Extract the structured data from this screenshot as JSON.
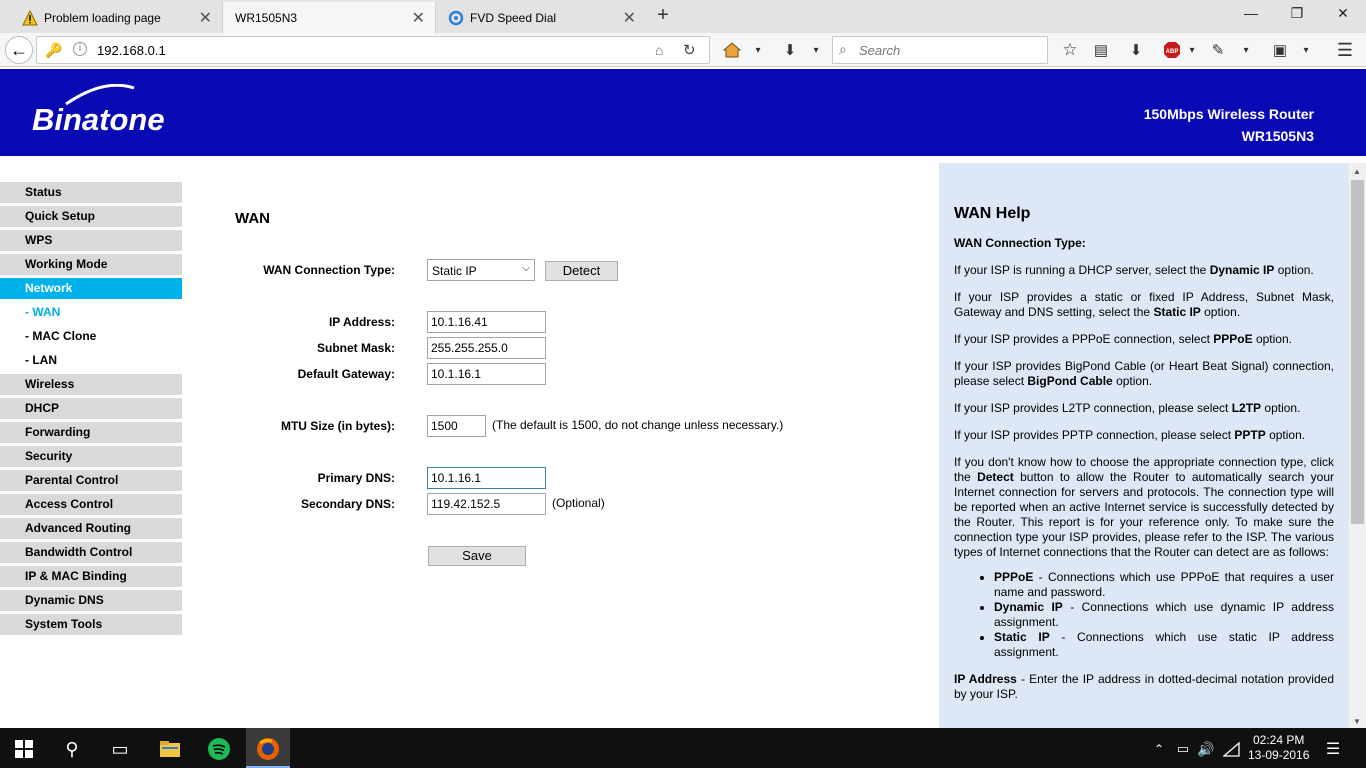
{
  "browser": {
    "tabs": [
      {
        "title": "Problem loading page"
      },
      {
        "title": "WR1505N3"
      },
      {
        "title": "FVD Speed Dial"
      }
    ],
    "url": "192.168.0.1",
    "search_placeholder": "Search"
  },
  "header": {
    "logo": "Binatone",
    "product_line1": "150Mbps Wireless Router",
    "product_line2": "WR1505N3"
  },
  "menu": [
    {
      "label": "Status"
    },
    {
      "label": "Quick Setup"
    },
    {
      "label": "WPS"
    },
    {
      "label": "Working Mode"
    },
    {
      "label": "Network",
      "selected": true
    },
    {
      "label": "- WAN",
      "sub": true,
      "selected": true
    },
    {
      "label": "- MAC Clone",
      "sub": true
    },
    {
      "label": "- LAN",
      "sub": true
    },
    {
      "label": "Wireless"
    },
    {
      "label": "DHCP"
    },
    {
      "label": "Forwarding"
    },
    {
      "label": "Security"
    },
    {
      "label": "Parental Control"
    },
    {
      "label": "Access Control"
    },
    {
      "label": "Advanced Routing"
    },
    {
      "label": "Bandwidth Control"
    },
    {
      "label": "IP & MAC Binding"
    },
    {
      "label": "Dynamic DNS"
    },
    {
      "label": "System Tools"
    }
  ],
  "wan": {
    "title": "WAN",
    "conn_type_label": "WAN Connection Type:",
    "conn_type_value": "Static IP",
    "detect_label": "Detect",
    "ip_label": "IP Address:",
    "ip_value": "10.1.16.41",
    "mask_label": "Subnet Mask:",
    "mask_value": "255.255.255.0",
    "gw_label": "Default Gateway:",
    "gw_value": "10.1.16.1",
    "mtu_label": "MTU Size (in bytes):",
    "mtu_value": "1500",
    "mtu_note": "(The default is 1500, do not change unless necessary.)",
    "pdns_label": "Primary DNS:",
    "pdns_value": "10.1.16.1",
    "sdns_label": "Secondary DNS:",
    "sdns_value": "119.42.152.5",
    "sdns_note": "(Optional)",
    "save_label": "Save"
  },
  "help": {
    "title": "WAN Help",
    "subtitle": "WAN Connection Type:",
    "p1_a": "If your ISP is running a DHCP server, select the ",
    "p1_b": "Dynamic IP",
    "p1_c": " option.",
    "p2_a": "If your ISP provides a static or fixed IP Address, Subnet Mask, Gateway and DNS setting, select the ",
    "p2_b": "Static IP",
    "p2_c": " option.",
    "p3_a": "If your ISP provides a PPPoE connection, select ",
    "p3_b": "PPPoE",
    "p3_c": " option.",
    "p4_a": "If your ISP provides BigPond Cable (or Heart Beat Signal) connection, please select ",
    "p4_b": "BigPond Cable",
    "p4_c": " option.",
    "p5_a": "If your ISP provides L2TP connection, please select ",
    "p5_b": "L2TP",
    "p5_c": " option.",
    "p6_a": "If your ISP provides PPTP connection, please select ",
    "p6_b": "PPTP",
    "p6_c": " option.",
    "p7_a": "If you don't know how to choose the appropriate connection type, click the ",
    "p7_b": "Detect",
    "p7_c": " button to allow the Router to automatically search your Internet connection for servers and protocols. The connection type will be reported when an active Internet service is successfully detected by the Router. This report is for your reference only. To make sure the connection type your ISP provides, please refer to the ISP. The various types of Internet connections that the Router can detect are as follows:",
    "li1_a": "PPPoE",
    "li1_b": " - Connections which use PPPoE that requires a user name and password.",
    "li2_a": "Dynamic IP",
    "li2_b": " - Connections which use dynamic IP address assignment.",
    "li3_a": "Static IP",
    "li3_b": " - Connections which use static IP address assignment.",
    "p8_a": "IP Address",
    "p8_b": " - Enter the IP address in dotted-decimal notation provided by your ISP."
  },
  "taskbar": {
    "time": "02:24 PM",
    "date": "13-09-2016"
  }
}
